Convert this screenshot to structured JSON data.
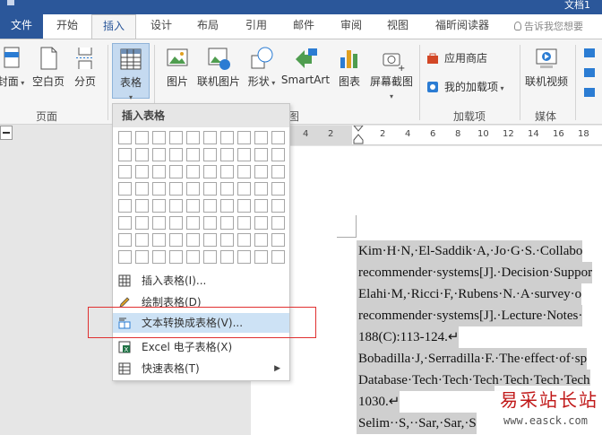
{
  "title_fragment": "文档1",
  "tabs": {
    "file": "文件",
    "home": "开始",
    "insert": "插入",
    "design": "设计",
    "layout": "布局",
    "references": "引用",
    "mailings": "邮件",
    "review": "审阅",
    "view": "视图",
    "foxit": "福昕阅读器"
  },
  "tell_me": "告诉我您想要",
  "ribbon": {
    "cover": "封面",
    "blank_page": "空白页",
    "page_break": "分页",
    "table": "表格",
    "pictures": "图片",
    "online_pictures": "联机图片",
    "shapes": "形状",
    "smartart": "SmartArt",
    "chart": "图表",
    "screenshot": "屏幕截图",
    "store": "应用商店",
    "my_addins": "我的加载项",
    "online_video": "联机视频",
    "group_pages": "页面",
    "group_illustrations_tail": "图",
    "group_addins": "加载项",
    "group_media": "媒体"
  },
  "dropdown": {
    "header": "插入表格",
    "insert_table": "插入表格(I)...",
    "draw_table": "绘制表格(D)",
    "text_to_table": "文本转换成表格(V)...",
    "excel_table": "Excel 电子表格(X)",
    "quick_tables": "快速表格(T)"
  },
  "ruler": {
    "left_numbers": [
      "4",
      "2"
    ],
    "right_numbers": [
      "2",
      "4",
      "6",
      "8",
      "10",
      "12",
      "14",
      "16",
      "18"
    ]
  },
  "document_lines": [
    "Kim·H·N,·El-Saddik·A,·Jo·G·S.·Collabo",
    "recommender·systems[J].·Decision·Suppor",
    "Elahi·M,·Ricci·F,·Rubens·N.·A·survey·o",
    "recommender·systems[J].·Lecture·Notes·",
    "188(C):113-124.↵",
    "Bobadilla·J,·Serradilla·F.·The·effect·of·sp",
    "Database·Tech·Tech·Tech·Tech·Tech·Tech",
    "1030.↵",
    "Selim··S,··Sar,·Sar,·S"
  ],
  "watermark": {
    "cn": "易采站长站",
    "url": "www.easck.com"
  },
  "colors": {
    "brand_blue": "#2b579a",
    "ribbon_bg": "#f5f5f5",
    "highlight": "#cde2f5",
    "callout_red": "#e03030"
  }
}
